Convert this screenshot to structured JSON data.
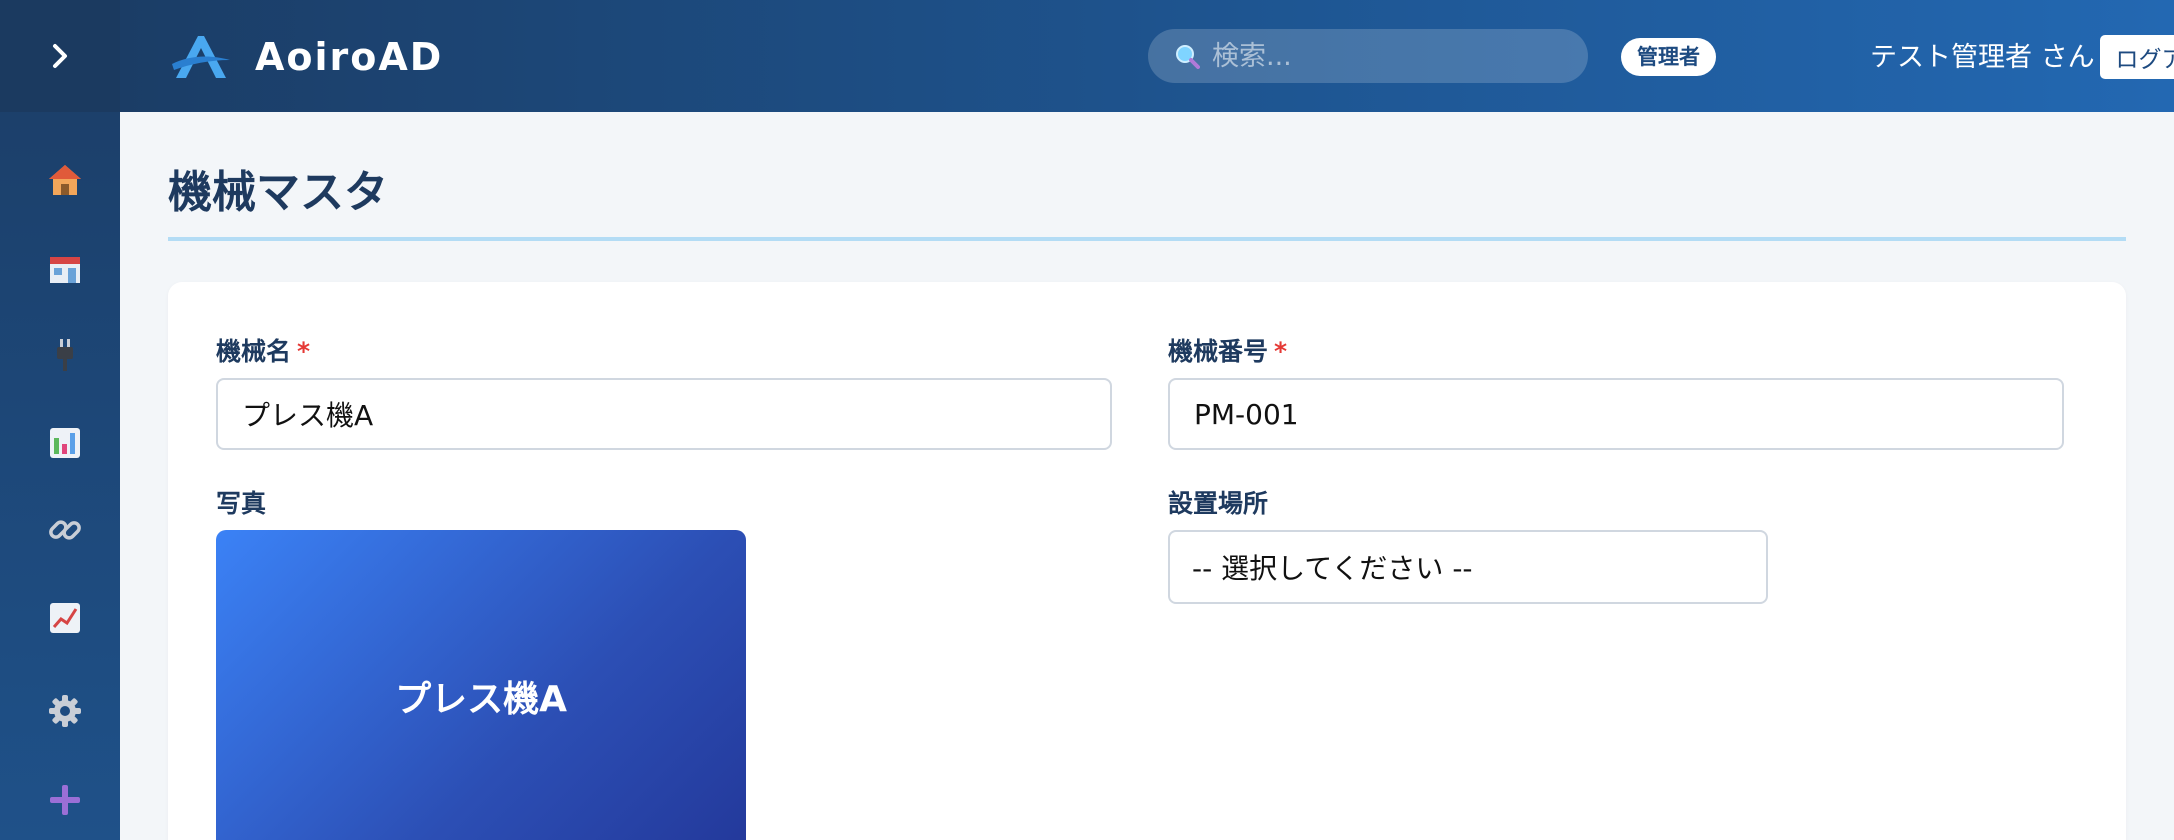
{
  "app": {
    "name": "AoiroAD"
  },
  "header": {
    "search_placeholder": "検索...",
    "role_badge": "管理者",
    "user_name": "テスト管理者 さん",
    "logout_label": "ログアウト"
  },
  "sidebar": {
    "toggle_icon": "chevron-right-icon",
    "items": [
      {
        "icon": "home-icon"
      },
      {
        "icon": "store-icon"
      },
      {
        "icon": "plug-icon"
      },
      {
        "icon": "bar-chart-icon"
      },
      {
        "icon": "link-icon"
      },
      {
        "icon": "line-chart-icon"
      },
      {
        "icon": "gear-icon"
      },
      {
        "icon": "plus-icon"
      }
    ]
  },
  "page": {
    "title": "機械マスタ"
  },
  "form": {
    "machine_name": {
      "label": "機械名",
      "required_mark": "*",
      "value": "プレス機A"
    },
    "machine_number": {
      "label": "機械番号",
      "required_mark": "*",
      "value": "PM-001"
    },
    "photo": {
      "label": "写真",
      "caption": "プレス機A"
    },
    "location": {
      "label": "設置場所",
      "selected": "-- 選択してください --"
    }
  },
  "colors": {
    "sidebar_bg": "#1b3d66",
    "header_bg_start": "#1b3d66",
    "header_bg_end": "#2368b2",
    "title_color": "#1e3a5f",
    "required_color": "#e53935",
    "title_rule": "#b3dcf5"
  }
}
